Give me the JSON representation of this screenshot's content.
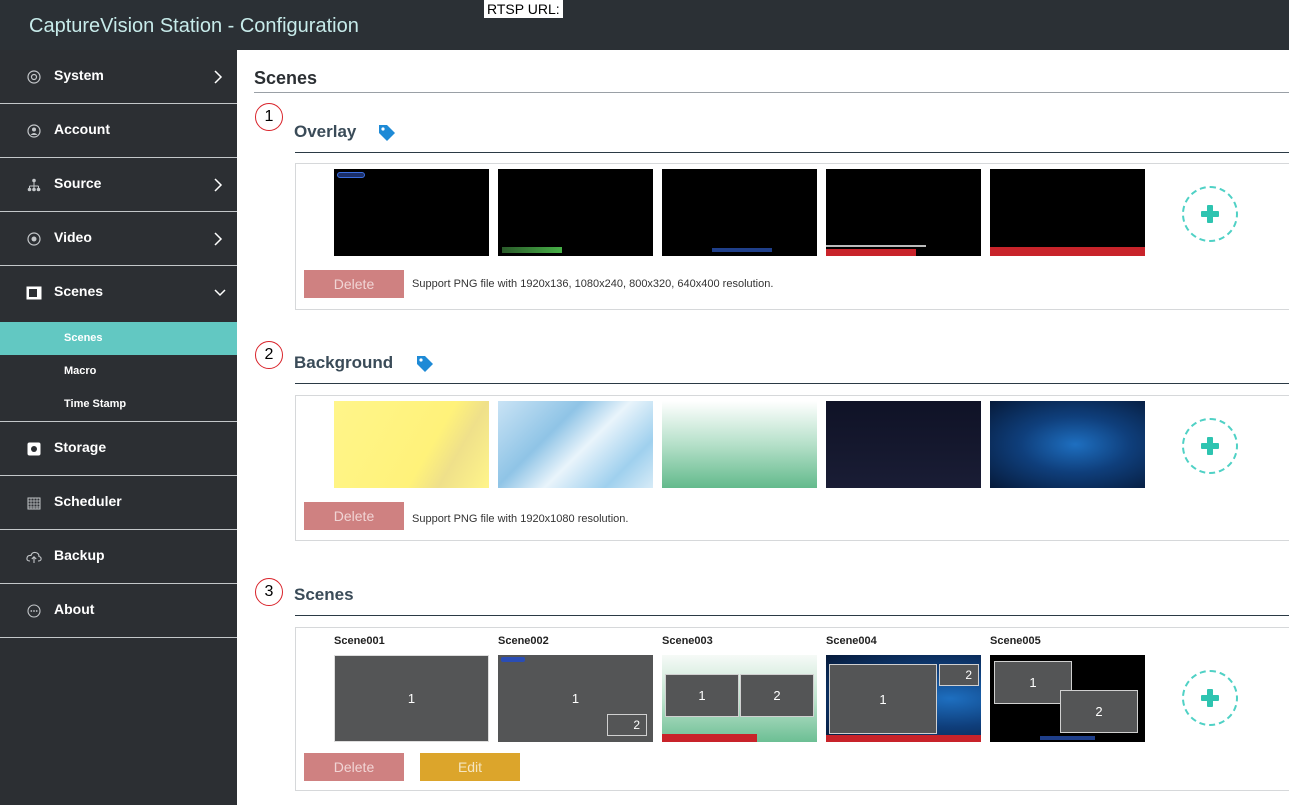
{
  "app": {
    "title": "CaptureVision Station - Configuration",
    "rtsp_label": "RTSP URL:"
  },
  "sidebar": {
    "items": [
      {
        "label": "System",
        "icon": "gear-circle-icon",
        "has_arrow": true
      },
      {
        "label": "Account",
        "icon": "user-circle-icon",
        "has_arrow": false
      },
      {
        "label": "Source",
        "icon": "network-tree-icon",
        "has_arrow": true
      },
      {
        "label": "Video",
        "icon": "record-circle-icon",
        "has_arrow": true
      },
      {
        "label": "Scenes",
        "icon": "scenes-window-icon",
        "has_arrow": true,
        "expanded": true
      },
      {
        "label": "Storage",
        "icon": "storage-icon",
        "has_arrow": false
      },
      {
        "label": "Scheduler",
        "icon": "calendar-icon",
        "has_arrow": false
      },
      {
        "label": "Backup",
        "icon": "cloud-upload-icon",
        "has_arrow": false
      },
      {
        "label": "About",
        "icon": "chat-dots-icon",
        "has_arrow": false
      }
    ],
    "sub_items": [
      {
        "label": "Scenes",
        "active": true
      },
      {
        "label": "Macro",
        "active": false
      },
      {
        "label": "Time Stamp",
        "active": false
      }
    ]
  },
  "main": {
    "page_title": "Scenes",
    "overlay": {
      "number": "1",
      "title": "Overlay",
      "delete_label": "Delete",
      "hint": "Support PNG file with 1920x136, 1080x240, 800x320, 640x400 resolution."
    },
    "background": {
      "number": "2",
      "title": "Background",
      "delete_label": "Delete",
      "hint": "Support PNG file with 1920x1080 resolution."
    },
    "scenes": {
      "number": "3",
      "title": "Scenes",
      "delete_label": "Delete",
      "edit_label": "Edit",
      "items": [
        {
          "name": "Scene001",
          "windows": [
            "1"
          ]
        },
        {
          "name": "Scene002",
          "windows": [
            "1",
            "2"
          ]
        },
        {
          "name": "Scene003",
          "windows": [
            "1",
            "2"
          ]
        },
        {
          "name": "Scene004",
          "windows": [
            "1",
            "2"
          ]
        },
        {
          "name": "Scene005",
          "windows": [
            "1",
            "2"
          ]
        }
      ]
    }
  },
  "colors": {
    "topbar": "#2b3035",
    "sidebar": "#2c2f33",
    "active_sub": "#62c8c2",
    "accent_teal": "#2ec4b0",
    "delete": "#cf8181",
    "edit": "#dca52b",
    "tag_blue": "#1e8ad6",
    "marker_red": "#d9232a"
  }
}
